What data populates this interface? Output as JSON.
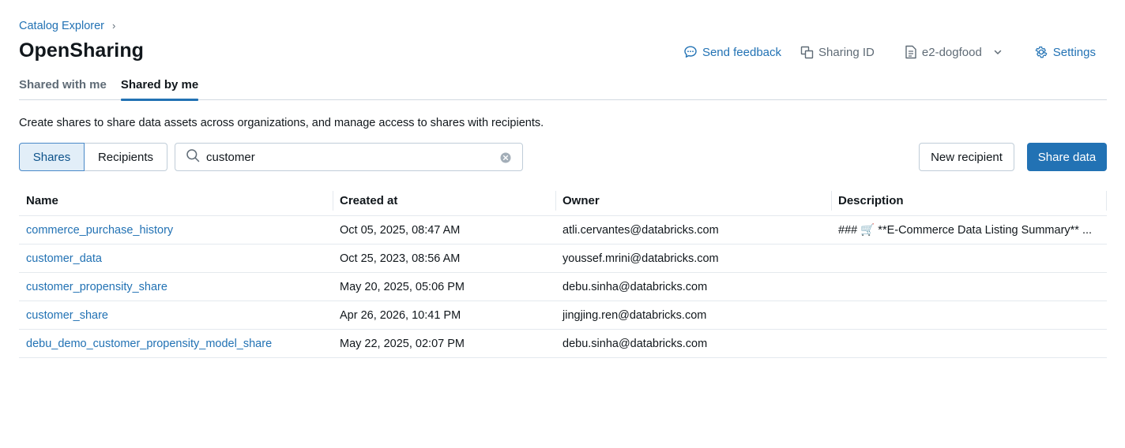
{
  "breadcrumb": {
    "parent": "Catalog Explorer",
    "separator": "›"
  },
  "page": {
    "title": "OpenSharing",
    "description": "Create shares to share data assets across organizations, and manage access to shares with recipients."
  },
  "header": {
    "send_feedback": "Send feedback",
    "sharing_id": "Sharing ID",
    "workspace": "e2-dogfood",
    "settings": "Settings"
  },
  "tabs": [
    {
      "label": "Shared with me",
      "active": false
    },
    {
      "label": "Shared by me",
      "active": true
    }
  ],
  "toolbar": {
    "segments": [
      {
        "label": "Shares",
        "selected": true
      },
      {
        "label": "Recipients",
        "selected": false
      }
    ],
    "search_value": "customer",
    "new_recipient": "New recipient",
    "share_data": "Share data"
  },
  "table": {
    "columns": [
      "Name",
      "Created at",
      "Owner",
      "Description"
    ],
    "rows": [
      {
        "name": "commerce_purchase_history",
        "created_at": "Oct 05, 2025, 08:47 AM",
        "owner": "atli.cervantes@databricks.com",
        "description": "### 🛒 **E-Commerce Data Listing Summary** ..."
      },
      {
        "name": "customer_data",
        "created_at": "Oct 25, 2023, 08:56 AM",
        "owner": "youssef.mrini@databricks.com",
        "description": ""
      },
      {
        "name": "customer_propensity_share",
        "created_at": "May 20, 2025, 05:06 PM",
        "owner": "debu.sinha@databricks.com",
        "description": ""
      },
      {
        "name": "customer_share",
        "created_at": "Apr 26, 2026, 10:41 PM",
        "owner": "jingjing.ren@databricks.com",
        "description": ""
      },
      {
        "name": "debu_demo_customer_propensity_model_share",
        "created_at": "May 22, 2025, 02:07 PM",
        "owner": "debu.sinha@databricks.com",
        "description": ""
      }
    ]
  },
  "colors": {
    "accent": "#2272b4",
    "text": "#11171c",
    "muted": "#5f6b76",
    "border": "#c0cdd8"
  }
}
